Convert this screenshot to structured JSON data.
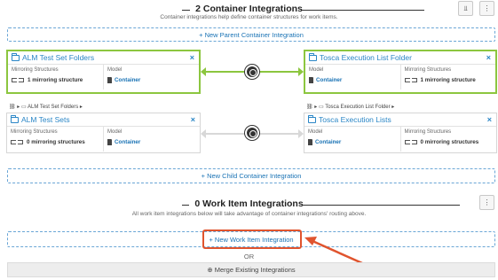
{
  "container_section": {
    "title": "2 Container Integrations",
    "subtitle": "Container integrations help define container structures for work items.",
    "chart_icon": "⫫",
    "menu_icon": "⋮",
    "new_parent_label": "+ New Parent Container Integration",
    "new_child_label": "+ New Child Container Integration"
  },
  "cards": {
    "alm_folders": {
      "title": "ALM Test Set Folders",
      "close": "×",
      "col1_label": "Mirroring Structures",
      "col1_value": "1 mirroring structure",
      "col2_label": "Model",
      "col2_value": "Container"
    },
    "tosca_folder": {
      "title": "Tosca Execution List Folder",
      "close": "×",
      "col1_label": "Model",
      "col1_value": "Container",
      "col2_label": "Mirroring Structures",
      "col2_value": "1 mirroring structure"
    },
    "alm_sets": {
      "title": "ALM Test Sets",
      "close": "×",
      "col1_label": "Mirroring Structures",
      "col1_value": "0 mirroring structures",
      "col2_label": "Model",
      "col2_value": "Container"
    },
    "tosca_lists": {
      "title": "Tosca Execution Lists",
      "close": "×",
      "col1_label": "Model",
      "col1_value": "Container",
      "col2_label": "Mirroring Structures",
      "col2_value": "0 mirroring structures"
    }
  },
  "breadcrumbs": {
    "left": "ALM Test Set Folders ▸",
    "right": "Tosca Execution List Folder ▸",
    "prefix": "⛓ ▸"
  },
  "colors": {
    "selected_border": "#8cc63f",
    "link": "#1a73b5",
    "annotation": "#e0542e"
  },
  "work_item_section": {
    "title": "0 Work Item Integrations",
    "subtitle": "All work item integrations below will take advantage of container integrations' routing above.",
    "menu_icon": "⋮",
    "new_label": "+ New Work Item Integration",
    "or_label": "OR",
    "merge_label": "⊕ Merge Existing Integrations"
  }
}
